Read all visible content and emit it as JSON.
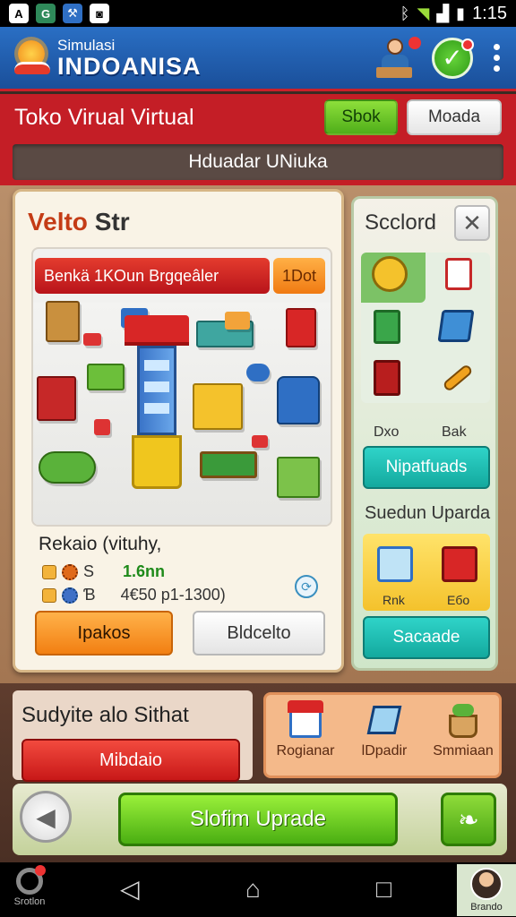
{
  "status_bar": {
    "time": "1:15",
    "left_icons": [
      "a-icon",
      "app-icon",
      "store-icon",
      "gallery-icon"
    ],
    "right_icons": [
      "bluetooth-icon",
      "wifi-icon",
      "signal-icon",
      "battery-icon"
    ]
  },
  "app": {
    "brand_sub": "Simulasi",
    "brand_main": "INDOANISA"
  },
  "title_bar": {
    "title": "Toko Virual Virtual",
    "btn_green": "Sbok",
    "btn_white": "Moada"
  },
  "strip": {
    "label": "Hduadar UNiuka"
  },
  "store": {
    "title_part1": "Velto",
    "title_part2": "Str",
    "banner": "Benkä 1KOun Brgqeâler",
    "banner_tag": "1Dot",
    "name": "Rekaio (vituhy,",
    "stat1_label": "S",
    "stat1_value": "1.6nn",
    "stat2_label": "Ɓ",
    "stat2_value": "4€50 p1-1300)",
    "btn_primary": "Ipakos",
    "btn_secondary": "Bldcelto"
  },
  "side_panel": {
    "title": "Scclord",
    "label_left": "Dxo",
    "label_right": "Bak",
    "btn1": "Nipatfuads",
    "subtitle": "Suedun Uparda",
    "shop_left": "Rnk",
    "shop_right": "Ебо",
    "btn2": "Sacaade"
  },
  "bottom": {
    "prompt": "Sudyite alo Sithat",
    "btn_red": "Mibdaio",
    "opt1": "Rogianar",
    "opt2": "lDpadir",
    "opt3": "Smmiaan",
    "btn_upgrade": "Slofim Uprade"
  },
  "nav": {
    "left_label": "Srotlon",
    "right_label": "Brando"
  },
  "colors": {
    "header_blue": "#1a4f9a",
    "title_red": "#c41e26",
    "accent_green": "#4fae1a",
    "accent_orange": "#f27f12",
    "accent_teal": "#13a99e"
  }
}
